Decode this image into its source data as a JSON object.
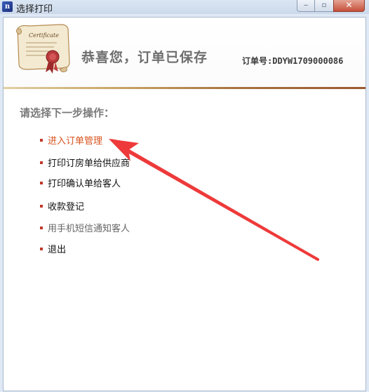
{
  "window": {
    "title": "选择打印",
    "app_icon_glyph": "n",
    "min_glyph": "‒",
    "max_glyph": "▫",
    "close_glyph": "✕"
  },
  "header": {
    "congrats": "恭喜您，订单已保存",
    "order_no": "订单号:DDYW1709000086",
    "icon": "certificate-scroll-icon"
  },
  "prompt": "请选择下一步操作：",
  "menu": [
    {
      "label": "进入订单管理",
      "state": "active"
    },
    {
      "label": "打印订房单给供应商",
      "state": "normal"
    },
    {
      "label": "打印确认单给客人",
      "state": "normal"
    },
    {
      "label": "收款登记",
      "state": "normal"
    },
    {
      "label": "用手机短信通知客人",
      "state": "muted"
    },
    {
      "label": "退出",
      "state": "normal"
    }
  ],
  "colors": {
    "active_text": "#d9531e",
    "bullet": "#c0392b",
    "arrow": "#ee3a3a"
  }
}
